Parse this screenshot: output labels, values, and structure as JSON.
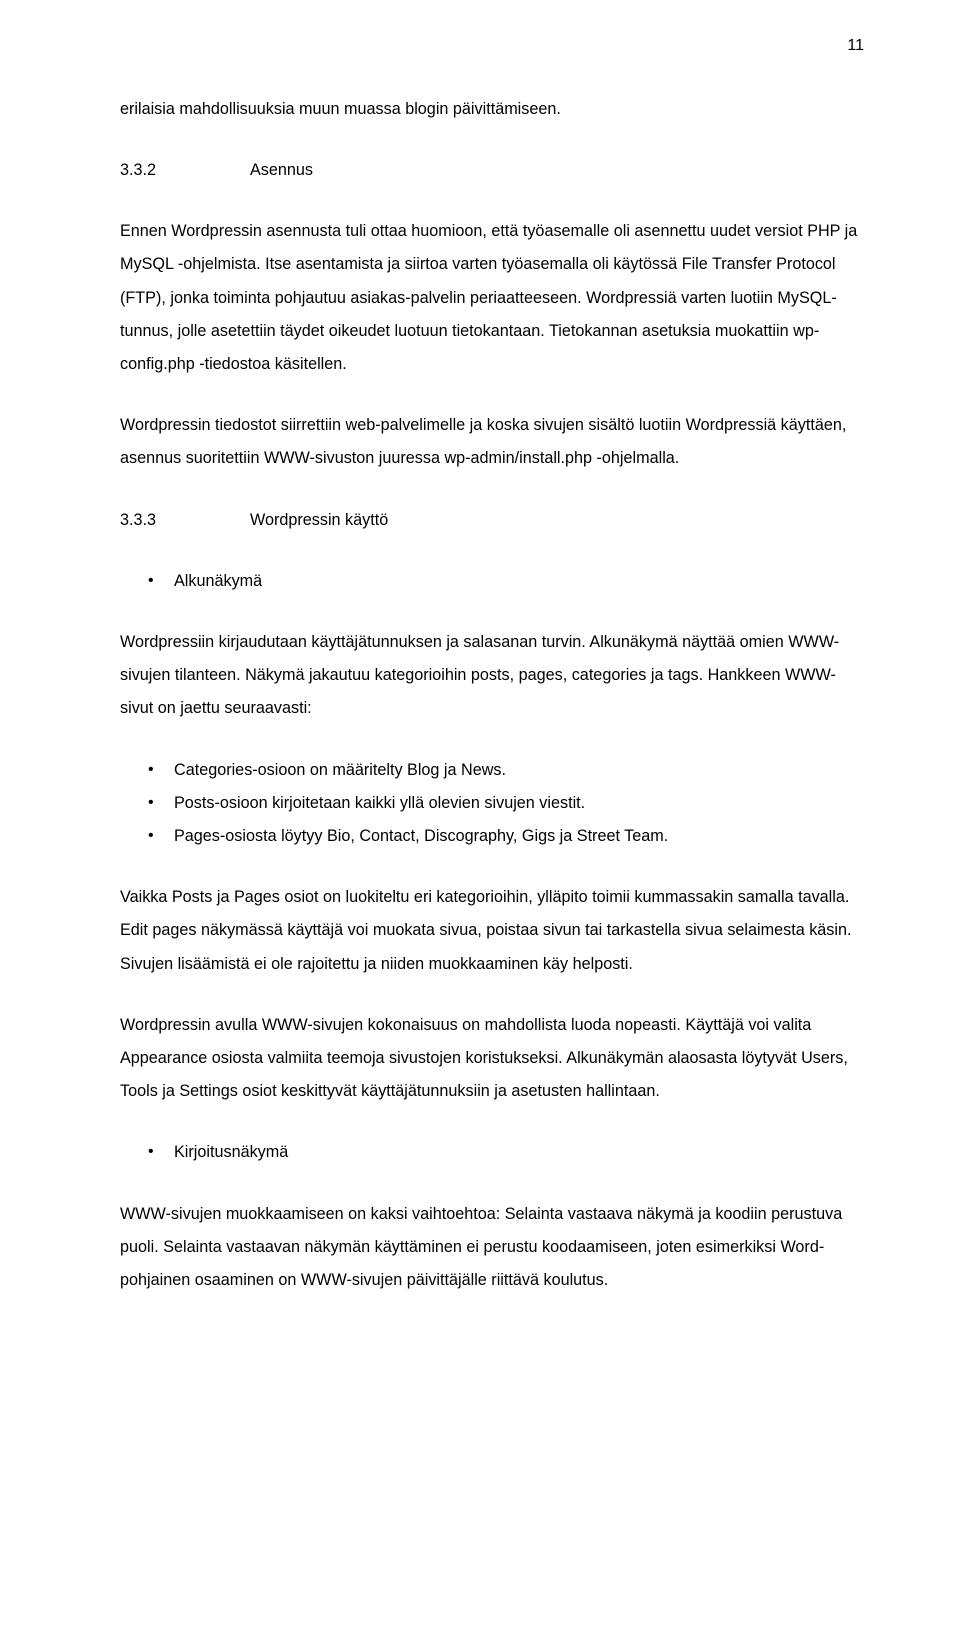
{
  "pageNumber": "11",
  "p1": "erilaisia mahdollisuuksia muun muassa blogin päivittämiseen.",
  "h1": {
    "num": "3.3.2",
    "text": "Asennus"
  },
  "p2": "Ennen Wordpressin asennusta tuli ottaa huomioon, että työasemalle oli asennettu uudet versiot PHP ja MySQL -ohjelmista. Itse asentamista ja siirtoa varten työasemalla oli käytössä File Transfer Protocol (FTP), jonka toiminta pohjautuu asiakas-palvelin periaatteeseen. Wordpressiä varten luotiin MySQL-tunnus, jolle asetettiin täydet oikeudet luotuun tietokantaan. Tietokannan asetuksia muokattiin wp-config.php -tiedostoa käsitellen.",
  "p3": "Wordpressin tiedostot siirrettiin web-palvelimelle ja koska sivujen sisältö luotiin Wordpressiä käyttäen, asennus suoritettiin WWW-sivuston juuressa wp-admin/install.php -ohjelmalla.",
  "h2": {
    "num": "3.3.3",
    "text": "Wordpressin käyttö"
  },
  "bullets1": [
    "Alkunäkymä"
  ],
  "p4": "Wordpressiin kirjaudutaan käyttäjätunnuksen ja salasanan turvin. Alkunäkymä näyttää omien WWW-sivujen tilanteen. Näkymä jakautuu kategorioihin posts, pages, categories ja tags. Hankkeen WWW-sivut on jaettu seuraavasti:",
  "bullets2": [
    "Categories-osioon on määritelty Blog ja News.",
    "Posts-osioon kirjoitetaan kaikki yllä olevien sivujen viestit.",
    "Pages-osiosta löytyy Bio, Contact, Discography, Gigs ja Street Team."
  ],
  "p5": "Vaikka Posts ja Pages osiot on luokiteltu eri kategorioihin, ylläpito toimii kummassakin samalla tavalla. Edit pages näkymässä käyttäjä voi muokata sivua, poistaa sivun tai tarkastella sivua selaimesta käsin. Sivujen lisäämistä ei ole rajoitettu ja niiden muokkaaminen käy helposti.",
  "p6": "Wordpressin avulla WWW-sivujen kokonaisuus on mahdollista luoda nopeasti. Käyttäjä voi valita Appearance osiosta valmiita teemoja sivustojen koristukseksi. Alkunäkymän alaosasta löytyvät Users, Tools ja Settings osiot keskittyvät käyttäjätunnuksiin ja asetusten hallintaan.",
  "bullets3": [
    "Kirjoitusnäkymä"
  ],
  "p7": "WWW-sivujen muokkaamiseen on kaksi vaihtoehtoa: Selainta vastaava näkymä ja koodiin perustuva puoli. Selainta vastaavan näkymän käyttäminen ei perustu koodaamiseen, joten esimerkiksi Word-pohjainen osaaminen on WWW-sivujen päivittäjälle riittävä koulutus."
}
